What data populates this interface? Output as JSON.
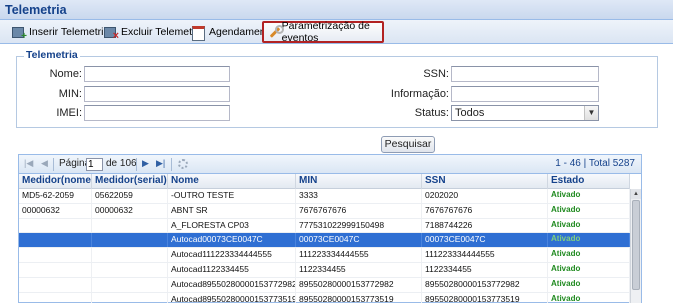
{
  "window": {
    "title": "Telemetria"
  },
  "toolbar": {
    "items": [
      {
        "label": "Inserir Telemetria",
        "icon": "add-device-icon"
      },
      {
        "label": "Excluir Telemetria",
        "icon": "delete-device-icon"
      },
      {
        "label": "Agendamento",
        "icon": "calendar-icon"
      },
      {
        "label": "Parametrização de eventos",
        "icon": "wrench-icon",
        "active": true
      }
    ]
  },
  "filter": {
    "legend": "Telemetria",
    "fields": {
      "nome": {
        "label": "Nome:",
        "value": ""
      },
      "min": {
        "label": "MIN:",
        "value": ""
      },
      "imei": {
        "label": "IMEI:",
        "value": ""
      },
      "ssn": {
        "label": "SSN:",
        "value": ""
      },
      "informacao": {
        "label": "Informação:",
        "value": ""
      },
      "status": {
        "label": "Status:",
        "value": "Todos"
      }
    },
    "search_label": "Pesquisar"
  },
  "pager": {
    "page_label": "Página",
    "page_value": "1",
    "of_label": "de 106",
    "info": "1 - 46 | Total 5287"
  },
  "grid": {
    "columns": [
      "Medidor(nome)",
      "Medidor(serial)",
      "Nome",
      "MIN",
      "SSN",
      "Estado"
    ],
    "rows": [
      [
        "MD5-62-2059",
        "05622059",
        "-OUTRO TESTE",
        "3333",
        "0202020",
        "Ativado"
      ],
      [
        "00000632",
        "00000632",
        "ABNT SR",
        "7676767676",
        "7676767676",
        "Ativado"
      ],
      [
        "",
        "",
        "A_FLORESTA CP03",
        "777531022999150498",
        "7188744226",
        "Ativado"
      ],
      [
        "",
        "",
        "Autocad00073CE0047C",
        "00073CE0047C",
        "00073CE0047C",
        "Ativado"
      ],
      [
        "",
        "",
        "Autocad111223334444555",
        "111223334444555",
        "111223334444555",
        "Ativado"
      ],
      [
        "",
        "",
        "Autocad1122334455",
        "1122334455",
        "1122334455",
        "Ativado"
      ],
      [
        "",
        "",
        "Autocad89550280000153772982",
        "89550280000153772982",
        "89550280000153772982",
        "Ativado"
      ],
      [
        "",
        "",
        "Autocad89550280000153773519",
        "89550280000153773519",
        "89550280000153773519",
        "Ativado"
      ]
    ],
    "selected_row": 3
  },
  "colors": {
    "title": "#15428b",
    "selection": "#2f6fd3",
    "status_active": "#1f8a1f",
    "active_tab_outline": "#b22222"
  }
}
